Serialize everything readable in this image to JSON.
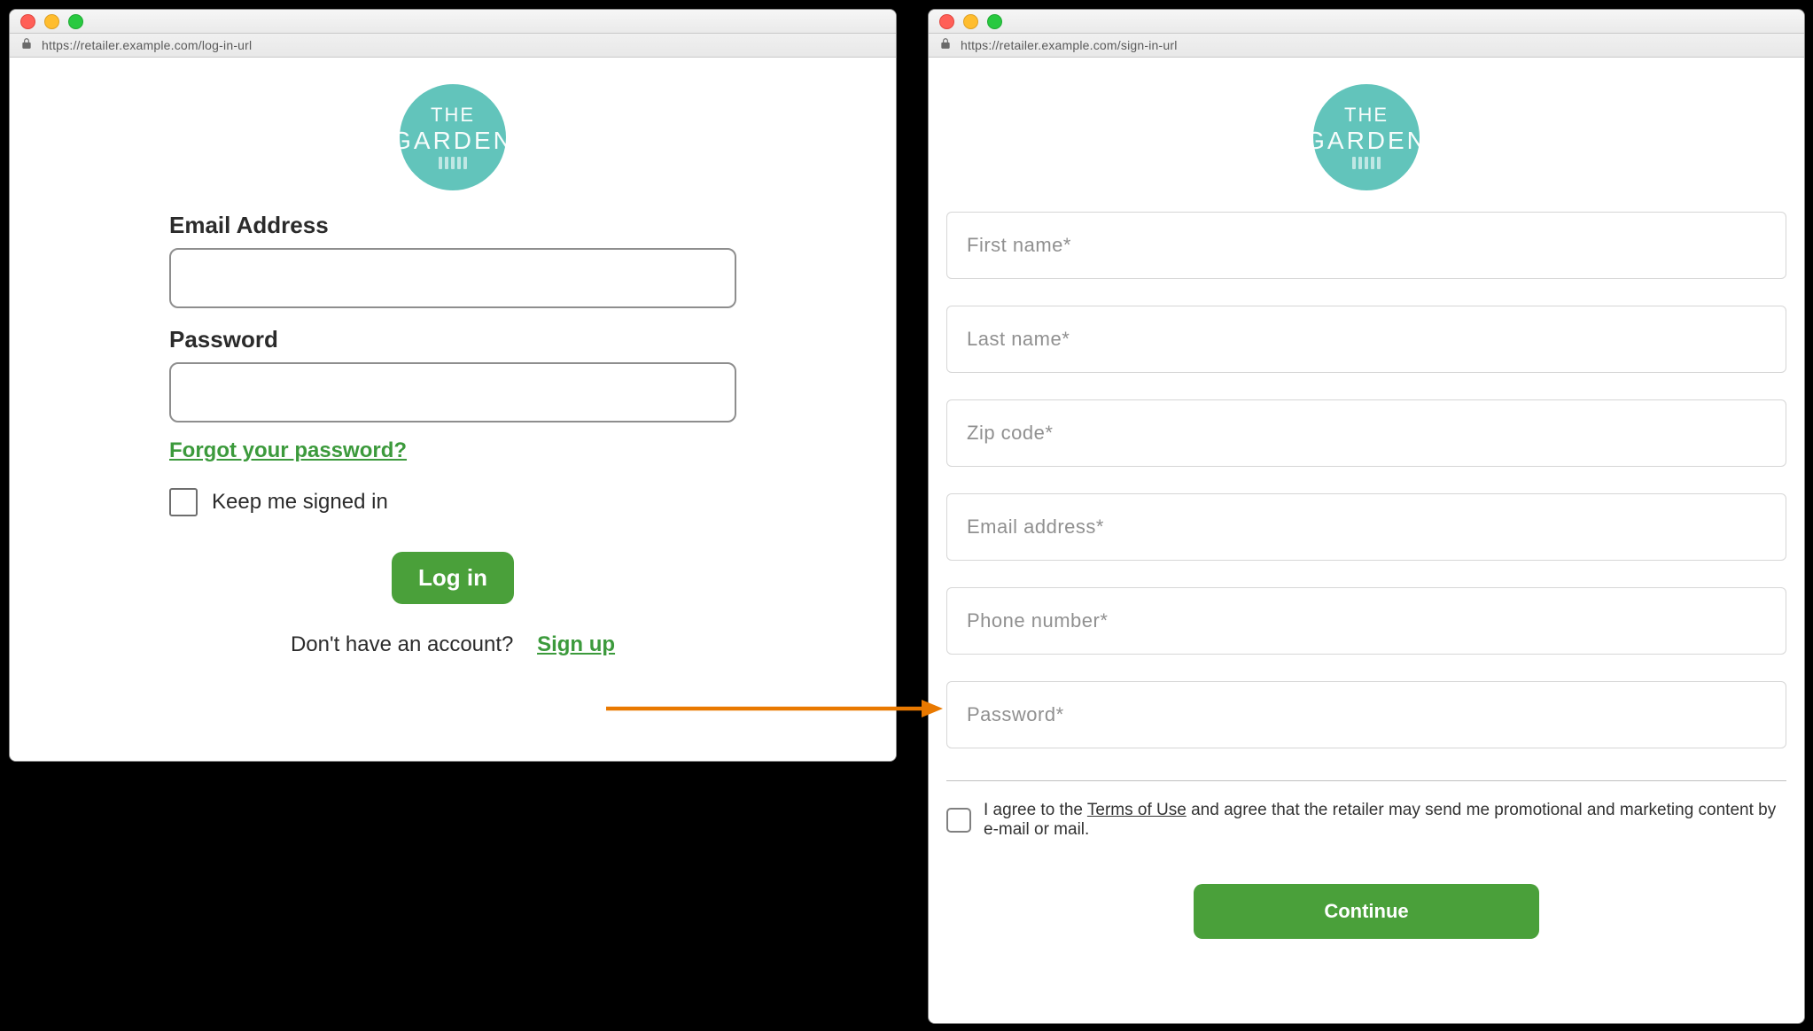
{
  "logo": {
    "line1": "THE",
    "line2": "GARDEN"
  },
  "login_window": {
    "url": "https://retailer.example.com/log-in-url",
    "email_label": "Email Address",
    "password_label": "Password",
    "forgot_link": "Forgot your password?",
    "keep_signed_in_label": "Keep me signed in",
    "login_button": "Log in",
    "no_account_text": "Don't have an account?",
    "signup_link": "Sign up"
  },
  "signup_window": {
    "url": "https://retailer.example.com/sign-in-url",
    "fields": {
      "first_name": "First name*",
      "last_name": "Last name*",
      "zip": "Zip code*",
      "email": "Email address*",
      "phone": "Phone number*",
      "password": "Password*"
    },
    "agree_prefix": "I agree to the ",
    "terms_link": "Terms of Use",
    "agree_suffix": " and agree that the retailer may send me promotional and marketing content by e-mail or mail.",
    "continue_button": "Continue"
  }
}
